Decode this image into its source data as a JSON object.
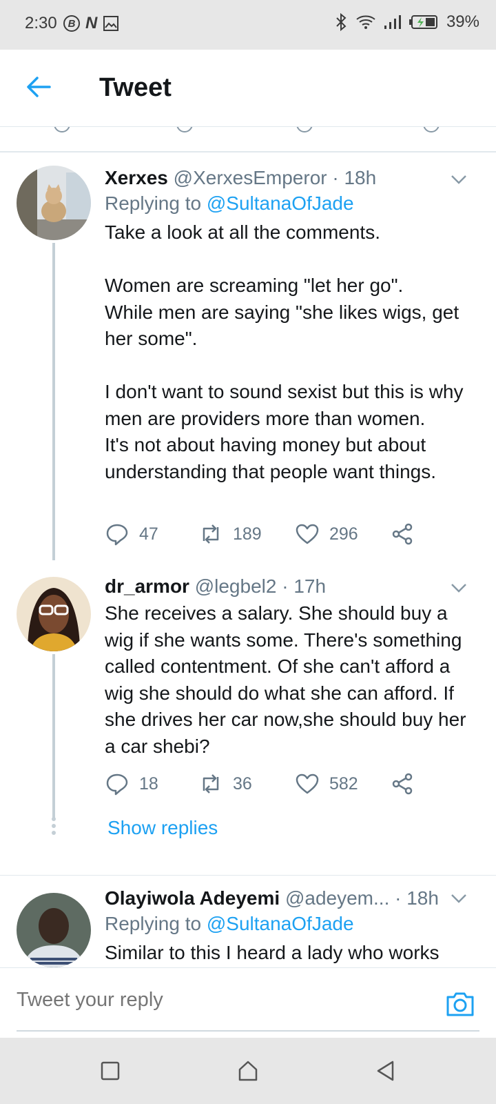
{
  "status_bar": {
    "time": "2:30",
    "battery_percent": "39%",
    "left_icons": [
      "b-circle-icon",
      "n-icon",
      "image-icon"
    ],
    "right_icons": [
      "bluetooth-icon",
      "wifi-icon",
      "signal-icon",
      "battery-charging-icon"
    ]
  },
  "header": {
    "title": "Tweet"
  },
  "tweets": [
    {
      "name": "Xerxes",
      "handle": "@XerxesEmperor",
      "time": "· 18h",
      "replying_prefix": "Replying to",
      "replying_to": "@SultanaOfJade",
      "text": "Take a look at all the comments.\n\n Women are screaming \"let her go\".\nWhile men are saying \"she likes wigs, get her some\".\n\nI don't want to sound sexist but this is why men are providers more than women.\nIt's not about having money but about understanding that people want things.",
      "replies": "47",
      "retweets": "189",
      "likes": "296"
    },
    {
      "name": "dr_armor",
      "handle": "@legbel2",
      "time": "· 17h",
      "text": "She receives a salary. She should buy a wig if she wants some. There's something called contentment. Of she can't afford a wig she should do what she can afford. If she drives her car now,she should buy her a car shebi?",
      "replies": "18",
      "retweets": "36",
      "likes": "582"
    },
    {
      "name": "Olayiwola Adeyemi",
      "handle": "@adeyem...",
      "time": "· 18h",
      "replying_prefix": "Replying to",
      "replying_to": "@SultanaOfJade",
      "text": "Similar to this I heard a lady who works"
    }
  ],
  "show_replies": "Show replies",
  "reply_bar": {
    "placeholder": "Tweet your reply"
  },
  "colors": {
    "accent": "#1da1f2",
    "secondary_text": "#657786",
    "primary_text": "#14171a"
  }
}
